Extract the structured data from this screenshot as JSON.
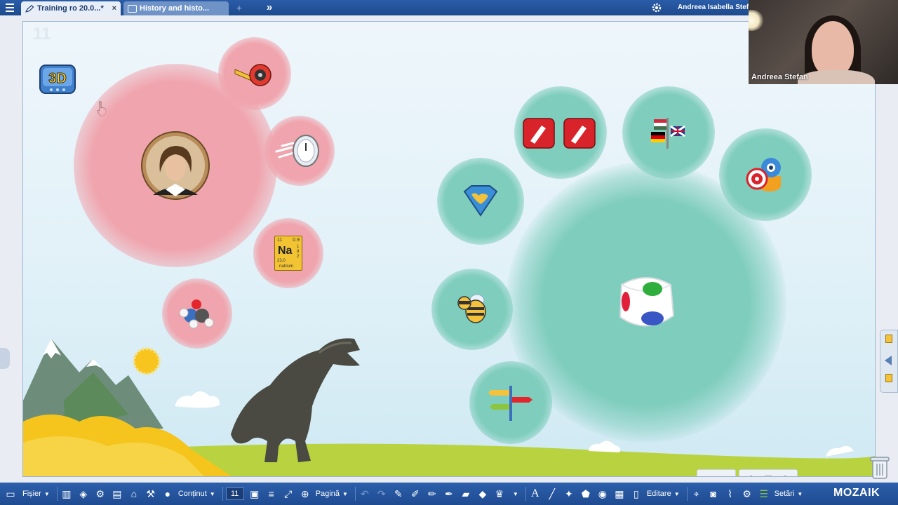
{
  "tabs": {
    "active": "Training ro 20.0...*",
    "inactive": "History and histo...",
    "close": "×",
    "new": "+",
    "more": "»"
  },
  "user": {
    "name": "Andreea Isabella Stef"
  },
  "webcam": {
    "label": "Andreea Stefan"
  },
  "stage": {
    "page_number": "11"
  },
  "pink_bubble_icons": [
    "3d-icon",
    "tape-measure-icon",
    "stopwatch-icon",
    "portrait-icon",
    "sodium-element-icon",
    "molecule-icon"
  ],
  "element_tile": {
    "number": "11",
    "mass_top": "0.9",
    "symbol": "Na",
    "weight": "23,0",
    "name": "natrium",
    "shells": "1 8 2"
  },
  "teal_bubble_icons": [
    "worksheet-icon",
    "flags-icon",
    "target-icon",
    "superhero-icon",
    "bee-icon",
    "signpost-icon",
    "dice-icon"
  ],
  "nav": {
    "prev": "‹",
    "next": "›"
  },
  "toolbar": {
    "file": "Fișier",
    "content": "Conținut",
    "page_num": "11",
    "page": "Pagină",
    "edit": "Editare",
    "settings": "Setări",
    "brand": "MOZAIK"
  },
  "colors": {
    "bar": "#2a5ca8",
    "pink": "#f0a4ad",
    "teal": "#7fcdbd"
  }
}
